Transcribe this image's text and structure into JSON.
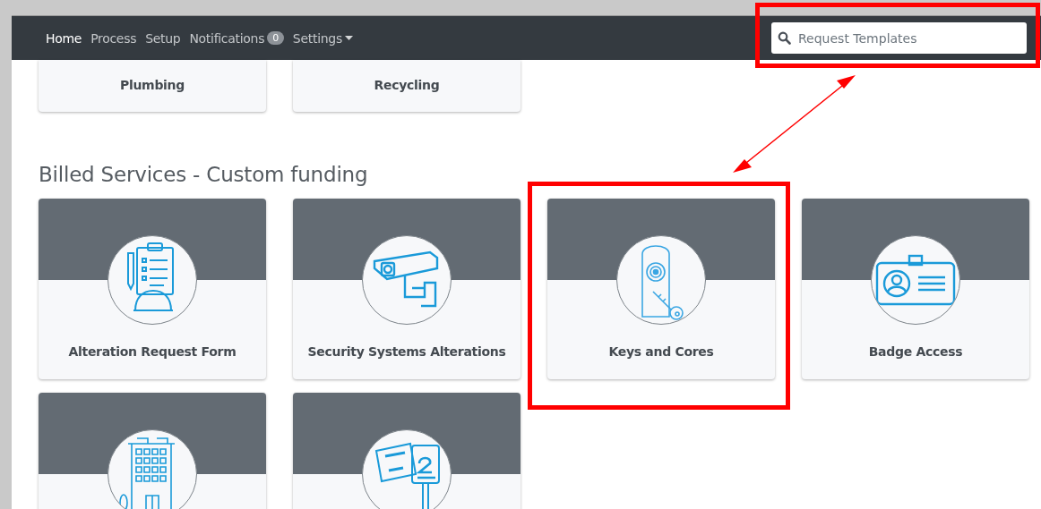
{
  "navbar": {
    "items": [
      {
        "label": "Home",
        "selected": true,
        "kind": "link"
      },
      {
        "label": "Process",
        "selected": false,
        "kind": "link"
      },
      {
        "label": "Setup",
        "selected": false,
        "kind": "link"
      },
      {
        "label": "Notifications",
        "selected": false,
        "kind": "badge",
        "badge": "0"
      },
      {
        "label": "Settings",
        "selected": false,
        "kind": "dropdown"
      }
    ],
    "search": {
      "placeholder": "Request Templates"
    }
  },
  "top_cards": [
    {
      "label": "Plumbing"
    },
    {
      "label": "Recycling"
    }
  ],
  "section": {
    "title": "Billed Services - Custom funding",
    "cards": [
      {
        "label": "Alteration Request Form",
        "kind": "checklist"
      },
      {
        "label": "Security Systems Alterations",
        "kind": "camera"
      },
      {
        "label": "Keys and Cores",
        "kind": "lock"
      },
      {
        "label": "Badge Access",
        "kind": "badge"
      },
      {
        "kind": "building"
      },
      {
        "kind": "signs"
      }
    ]
  },
  "annotations": [
    {
      "kind": "search_box"
    },
    {
      "kind": "card_box"
    },
    {
      "kind": "arrow"
    }
  ]
}
